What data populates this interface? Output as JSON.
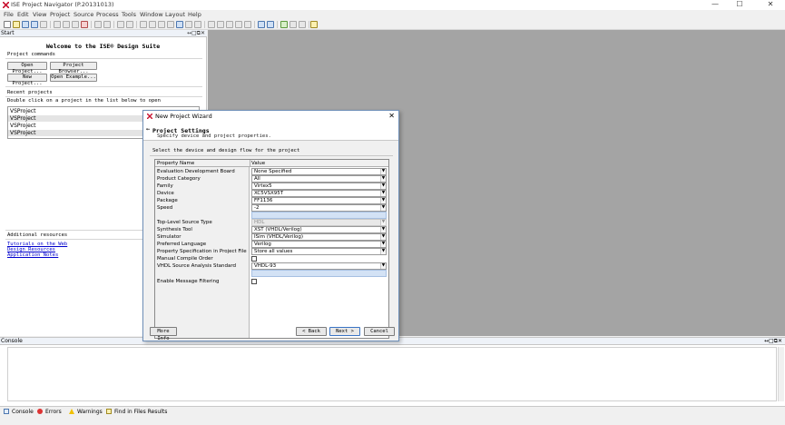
{
  "window": {
    "title": "ISE Project Navigator (P.20131013)",
    "minimize": "—",
    "maximize": "☐",
    "close": "✕"
  },
  "menu": [
    "File",
    "Edit",
    "View",
    "Project",
    "Source",
    "Process",
    "Tools",
    "Window",
    "Layout",
    "Help"
  ],
  "start_panel": {
    "tab": "Start",
    "controls": "↔□⧉✕",
    "welcome": "Welcome to the ISE® Design Suite",
    "project_commands_label": "Project commands",
    "buttons": {
      "open_project": "Open Project...",
      "project_browser": "Project Browser...",
      "new_project": "New Project...",
      "open_example": "Open Example..."
    },
    "recent_label": "Recent projects",
    "recent_hint": "Double click on a project in the list below to open",
    "recent_projects": [
      "VSProject",
      "VSProject",
      "VSProject",
      "VSProject"
    ],
    "additional_label": "Additional resources",
    "links": {
      "tutorials": "Tutorials on the Web",
      "design_resources": "Design Resources",
      "app_notes": "Application Notes"
    }
  },
  "console": {
    "title": "Console",
    "controls": "↔□⧉✕"
  },
  "status_tabs": {
    "console": "Console",
    "errors": "Errors",
    "warnings": "Warnings",
    "find": "Find in Files Results"
  },
  "dialog": {
    "title": "New Project Wizard",
    "close": "✕",
    "back_arrow": "←",
    "header_title": "Project Settings",
    "header_subtitle": "Specify device and project properties.",
    "select_hint": "Select the device and design flow for the project",
    "columns": {
      "property": "Property Name",
      "value": "Value"
    },
    "rows": {
      "eval_board": {
        "label": "Evaluation Development Board",
        "value": "None Specified"
      },
      "category": {
        "label": "Product Category",
        "value": "All"
      },
      "family": {
        "label": "Family",
        "value": "Virtex5"
      },
      "device": {
        "label": "Device",
        "value": "XC5VSX95T"
      },
      "package": {
        "label": "Package",
        "value": "FF1136"
      },
      "speed": {
        "label": "Speed",
        "value": "-2"
      },
      "top_level": {
        "label": "Top-Level Source Type",
        "value": "HDL"
      },
      "synthesis": {
        "label": "Synthesis Tool",
        "value": "XST (VHDL/Verilog)"
      },
      "simulator": {
        "label": "Simulator",
        "value": "ISim (VHDL/Verilog)"
      },
      "language": {
        "label": "Preferred Language",
        "value": "Verilog"
      },
      "prop_spec": {
        "label": "Property Specification in Project File",
        "value": "Store all values"
      },
      "manual_compile": {
        "label": "Manual Compile Order"
      },
      "vhdl_std": {
        "label": "VHDL Source Analysis Standard",
        "value": "VHDL-93"
      },
      "msg_filter": {
        "label": "Enable Message Filtering"
      }
    },
    "buttons": {
      "more_info": "More Info",
      "back": "< Back",
      "next": "Next >",
      "cancel": "Cancel"
    }
  }
}
